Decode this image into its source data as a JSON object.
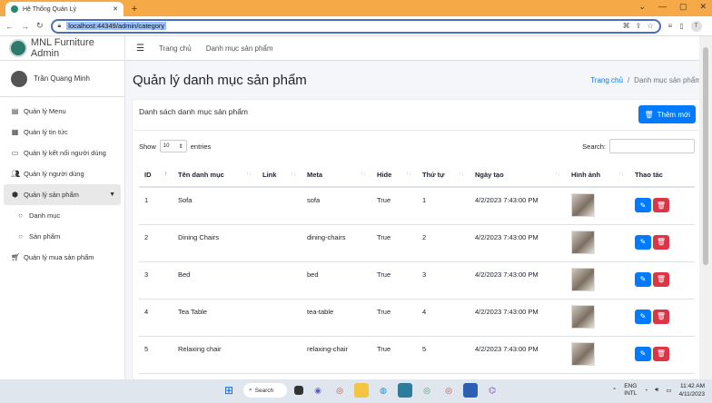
{
  "browser": {
    "tab_title": "Hệ Thống Quản Lý",
    "url": "localhost:44349/admin/category",
    "profile_initial": "T"
  },
  "sidebar": {
    "brand": "MNL Furniture Admin",
    "user_name": "Trần Quang Minh",
    "items": [
      {
        "label": "Quản lý Menu",
        "icon": "table-icon"
      },
      {
        "label": "Quản lý tin tức",
        "icon": "newspaper-icon"
      },
      {
        "label": "Quản lý kết nối người dùng",
        "icon": "id-card-icon"
      },
      {
        "label": "Quản lý người dùng",
        "icon": "users-icon"
      },
      {
        "label": "Quản lý sản phẩm",
        "icon": "box-icon"
      },
      {
        "label": "Danh mục",
        "icon": "circle-icon"
      },
      {
        "label": "Sản phẩm",
        "icon": "circle-icon"
      },
      {
        "label": "Quản lý mua sản phẩm",
        "icon": "cart-icon"
      }
    ]
  },
  "topnav": {
    "home": "Trang chủ",
    "category": "Danh mục sản phẩm"
  },
  "page": {
    "title": "Quản lý danh mục sản phẩm",
    "breadcrumb_home": "Trang chủ",
    "breadcrumb_sep": "/",
    "breadcrumb_current": "Danh mục sản phẩm"
  },
  "card": {
    "title": "Danh sách danh mục sản phẩm",
    "add_button": "Thêm mới",
    "show_label": "Show",
    "length_value": "10",
    "entries_label": "entries",
    "search_label": "Search:"
  },
  "table": {
    "headers": [
      "ID",
      "Tên danh mục",
      "Link",
      "Meta",
      "Hide",
      "Thứ tự",
      "Ngày tạo",
      "Hình ảnh",
      "Thao tác"
    ],
    "rows": [
      [
        "1",
        "Sofa",
        "",
        "sofa",
        "True",
        "1",
        "4/2/2023 7:43:00 PM"
      ],
      [
        "2",
        "Dining Chairs",
        "",
        "dining-chairs",
        "True",
        "2",
        "4/2/2023 7:43:00 PM"
      ],
      [
        "3",
        "Bed",
        "",
        "bed",
        "True",
        "3",
        "4/2/2023 7:43:00 PM"
      ],
      [
        "4",
        "Tea Table",
        "",
        "tea-table",
        "True",
        "4",
        "4/2/2023 7:43:00 PM"
      ],
      [
        "5",
        "Relaxing chair",
        "",
        "relaxing-chair",
        "True",
        "5",
        "4/2/2023 7:43:00 PM"
      ]
    ]
  },
  "taskbar": {
    "search": "Search",
    "lang": "ENG",
    "lang2": "INTL",
    "time": "11:42 AM",
    "date": "4/11/2023"
  }
}
